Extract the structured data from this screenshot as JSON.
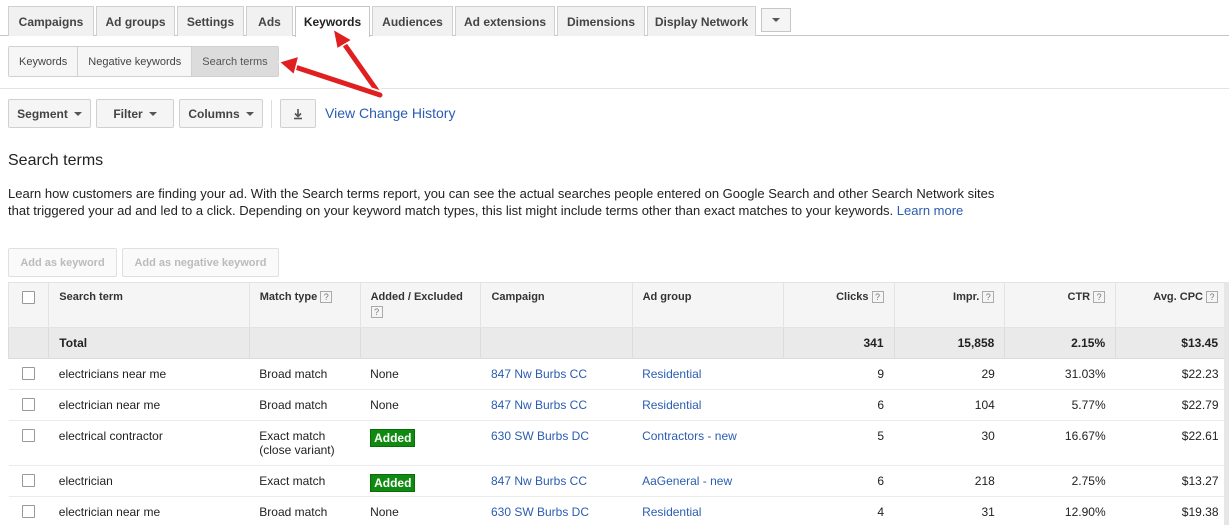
{
  "tabs": [
    "Campaigns",
    "Ad groups",
    "Settings",
    "Ads",
    "Keywords",
    "Audiences",
    "Ad extensions",
    "Dimensions",
    "Display Network"
  ],
  "active_tab": "Keywords",
  "subtabs": [
    "Keywords",
    "Negative keywords",
    "Search terms"
  ],
  "active_subtab": "Search terms",
  "toolbar": {
    "segment": "Segment",
    "filter": "Filter",
    "columns": "Columns",
    "download_icon": "download-icon",
    "view_history": "View Change History"
  },
  "section": {
    "title": "Search terms",
    "description": "Learn how customers are finding your ad. With the Search terms report, you can see the actual searches people entered on Google Search and other Search Network sites that triggered your ad and led to a click. Depending on your keyword match types, this list might include terms other than exact matches to your keywords.",
    "learn_more": "Learn more"
  },
  "actions": {
    "add_keyword": "Add as keyword",
    "add_negative": "Add as negative keyword"
  },
  "table": {
    "headers": [
      "Search term",
      "Match type",
      "Added / Excluded",
      "Campaign",
      "Ad group",
      "Clicks",
      "Impr.",
      "CTR",
      "Avg. CPC"
    ],
    "total": {
      "label": "Total",
      "clicks": "341",
      "impr": "15,858",
      "ctr": "2.15%",
      "cpc": "$13.45"
    },
    "rows": [
      {
        "term": "electricians near me",
        "match": "Broad match",
        "match2": "",
        "added": "None",
        "added_badge": false,
        "campaign": "847 Nw Burbs CC",
        "adgroup": "Residential",
        "clicks": "9",
        "impr": "29",
        "ctr": "31.03%",
        "cpc": "$22.23"
      },
      {
        "term": "electrician near me",
        "match": "Broad match",
        "match2": "",
        "added": "None",
        "added_badge": false,
        "campaign": "847 Nw Burbs CC",
        "adgroup": "Residential",
        "clicks": "6",
        "impr": "104",
        "ctr": "5.77%",
        "cpc": "$22.79"
      },
      {
        "term": "electrical contractor",
        "match": "Exact match",
        "match2": "(close variant)",
        "added": "Added",
        "added_badge": true,
        "campaign": "630 SW Burbs DC",
        "adgroup": "Contractors - new",
        "clicks": "5",
        "impr": "30",
        "ctr": "16.67%",
        "cpc": "$22.61"
      },
      {
        "term": "electrician",
        "match": "Exact match",
        "match2": "",
        "added": "Added",
        "added_badge": true,
        "campaign": "847 Nw Burbs CC",
        "adgroup": "AaGeneral - new",
        "clicks": "6",
        "impr": "218",
        "ctr": "2.75%",
        "cpc": "$13.27"
      },
      {
        "term": "electrician near me",
        "match": "Broad match",
        "match2": "",
        "added": "None",
        "added_badge": false,
        "campaign": "630 SW Burbs DC",
        "adgroup": "Residential",
        "clicks": "4",
        "impr": "31",
        "ctr": "12.90%",
        "cpc": "$19.38"
      }
    ]
  },
  "colors": {
    "link": "#2a5db0",
    "badge": "#118a11",
    "arrow": "#e02020"
  }
}
